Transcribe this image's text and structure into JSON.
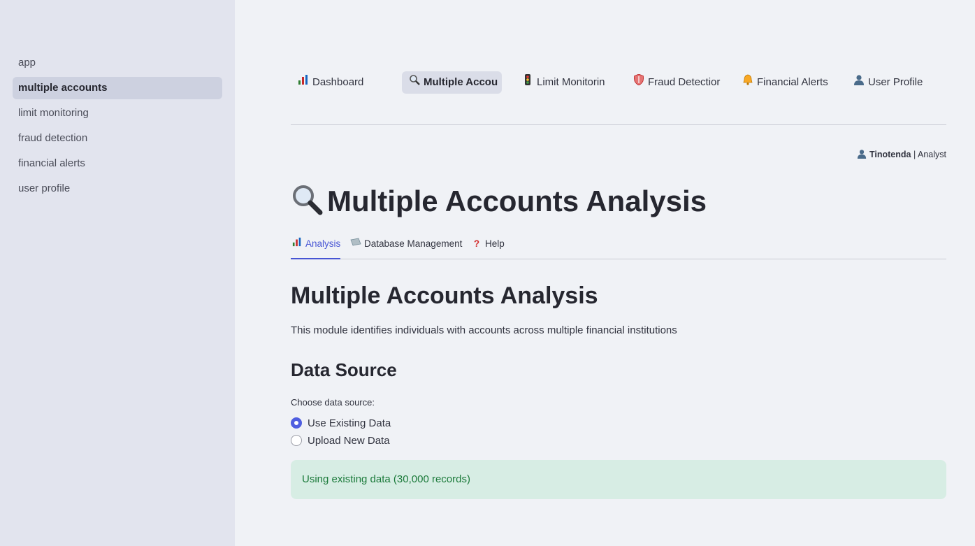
{
  "sidebar": {
    "items": [
      {
        "label": "app"
      },
      {
        "label": "multiple accounts"
      },
      {
        "label": "limit monitoring"
      },
      {
        "label": "fraud detection"
      },
      {
        "label": "financial alerts"
      },
      {
        "label": "user profile"
      }
    ],
    "active_index": 1
  },
  "nav": {
    "items": [
      {
        "label": "Dashboard",
        "icon": "bar-chart-icon"
      },
      {
        "label": "Multiple Accou",
        "icon": "magnifier-icon"
      },
      {
        "label": "Limit Monitorin",
        "icon": "traffic-light-icon"
      },
      {
        "label": "Fraud Detectior",
        "icon": "shield-icon"
      },
      {
        "label": "Financial Alerts",
        "icon": "bell-icon"
      },
      {
        "label": "User Profile",
        "icon": "user-icon"
      }
    ],
    "active_index": 1
  },
  "user": {
    "name": "Tinotenda",
    "separator": "|",
    "role": "Analyst"
  },
  "page": {
    "title": "Multiple Accounts Analysis",
    "title_icon": "magnifier-icon"
  },
  "tabs": [
    {
      "label": "Analysis",
      "icon": "bar-chart-icon"
    },
    {
      "label": "Database Management",
      "icon": "file-cabinet-icon"
    },
    {
      "label": "Help",
      "icon": "question-icon"
    }
  ],
  "content": {
    "heading": "Multiple Accounts Analysis",
    "description": "This module identifies individuals with accounts across multiple financial institutions",
    "data_source_heading": "Data Source",
    "radio_label": "Choose data source:",
    "radio_options": [
      {
        "label": "Use Existing Data",
        "selected": true
      },
      {
        "label": "Upload New Data",
        "selected": false
      }
    ],
    "status": "Using existing data (30,000 records)"
  },
  "colors": {
    "accent": "#4755d4",
    "success_bg": "#d7ede4",
    "success_text": "#1b7a3a",
    "sidebar_bg": "#e2e4ee"
  }
}
